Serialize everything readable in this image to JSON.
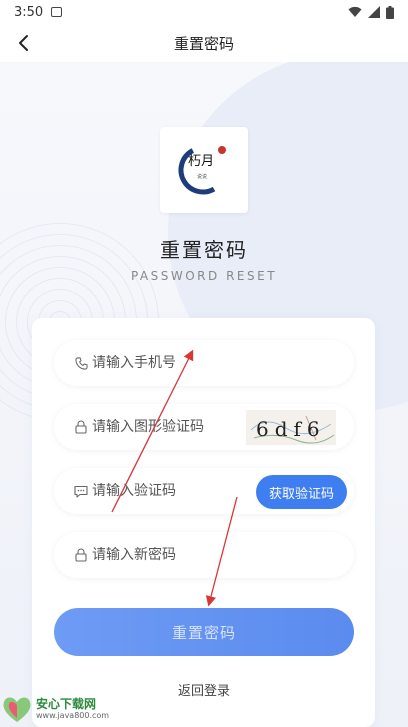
{
  "status_bar": {
    "time": "3:50"
  },
  "header": {
    "title": "重置密码"
  },
  "hero": {
    "title": "重置密码",
    "subtitle": "PASSWORD RESET",
    "logo_text_main": "朽月",
    "logo_text_small": "说说"
  },
  "form": {
    "phone_placeholder": "请输入手机号",
    "captcha_placeholder": "请输入图形验证码",
    "captcha_text": "6df6",
    "sms_placeholder": "请输入验证码",
    "get_code_label": "获取验证码",
    "new_password_placeholder": "请输入新密码",
    "submit_label": "重置密码",
    "back_to_login_label": "返回登录"
  },
  "watermark": {
    "title": "安心下载网",
    "url": "www.java800.com"
  },
  "icons": {
    "back": "chevron-left-icon",
    "phone": "phone-icon",
    "lock": "lock-icon",
    "message": "message-icon",
    "wifi": "wifi-icon",
    "signal": "signal-icon",
    "battery": "battery-icon"
  },
  "colors": {
    "accent": "#3f7ef0",
    "submit": "#6e9bf4",
    "annotation": "#d93636"
  }
}
